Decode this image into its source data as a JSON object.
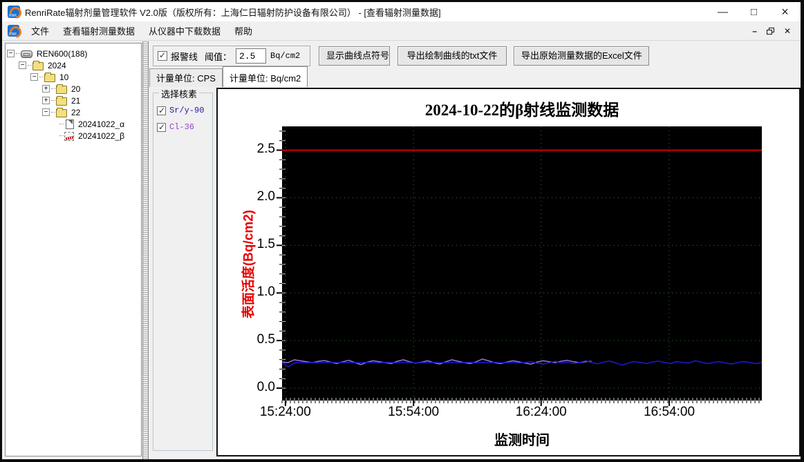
{
  "window": {
    "title": "RenriRate辐射剂量管理软件 V2.0版（版权所有：上海仁日辐射防护设备有限公司） - [查看辐射测量数据]",
    "minimize": "—",
    "maximize": "□",
    "close": "×",
    "mdi_minimize": "–",
    "mdi_close": "✕"
  },
  "menu": {
    "items": [
      "文件",
      "查看辐射测量数据",
      "从仪器中下载数据",
      "帮助"
    ]
  },
  "tree": {
    "items": [
      {
        "level": 0,
        "expander": "-",
        "icon": "device",
        "label": "REN600(188)",
        "selected": false
      },
      {
        "level": 1,
        "expander": "-",
        "icon": "folder",
        "label": "2024",
        "selected": false
      },
      {
        "level": 2,
        "expander": "-",
        "icon": "folder",
        "label": "10",
        "selected": false
      },
      {
        "level": 3,
        "expander": "+",
        "icon": "folder",
        "label": "20",
        "selected": false
      },
      {
        "level": 3,
        "expander": "+",
        "icon": "folder",
        "label": "21",
        "selected": false
      },
      {
        "level": 3,
        "expander": "-",
        "icon": "folder",
        "label": "22",
        "selected": false
      },
      {
        "level": 4,
        "expander": null,
        "icon": "doc",
        "label": "20241022_α",
        "selected": false
      },
      {
        "level": 4,
        "expander": null,
        "icon": "chart",
        "label": "20241022_β",
        "selected": true
      }
    ]
  },
  "toolbar": {
    "alarm_label": "报警线",
    "alarm_checked": true,
    "threshold_label": "阈值：",
    "threshold_value": "2.5",
    "threshold_unit": "Bq/cm2",
    "show_points_button": "显示曲线点符号",
    "export_txt_button": "导出绘制曲线的txt文件",
    "export_excel_button": "导出原始测量数据的Excel文件"
  },
  "tabs": [
    {
      "label": "计量单位: CPS",
      "active": false
    },
    {
      "label": "计量单位: Bq/cm2",
      "active": true
    }
  ],
  "nuclide_panel": {
    "title": "选择核素",
    "items": [
      {
        "label": "Sr/y-90",
        "checked": true,
        "color": "#24159a"
      },
      {
        "label": "Cl-36",
        "checked": true,
        "color": "#9b3fc9"
      }
    ]
  },
  "chart_data": {
    "type": "line",
    "title": "2024-10-22的β射线监测数据",
    "xlabel": "监测时间",
    "ylabel": "表面活度(Bq/cm2)",
    "ylabel_color": "#e60000",
    "plot_bg": "#000000",
    "grid_color": "#2e7d2e",
    "grid": true,
    "ylim": [
      -0.13,
      2.75
    ],
    "yticks": [
      0.0,
      0.5,
      1.0,
      1.5,
      2.0,
      2.5
    ],
    "ytick_labels": [
      "0.0",
      "0.5",
      "1.0",
      "1.5",
      "2.0",
      "2.5"
    ],
    "xtick_labels": [
      "15:24:00",
      "15:54:00",
      "16:24:00",
      "16:54:00"
    ],
    "xtick_fractions": [
      0.007,
      0.274,
      0.54,
      0.807
    ],
    "alarm_line": {
      "value": 2.5,
      "color": "#d40000"
    },
    "series": [
      {
        "name": "Cl-36",
        "color": "#9a74d8",
        "x_start": 0,
        "x_end": 0.645,
        "values": [
          0.275,
          0.268,
          0.298,
          0.288,
          0.278,
          0.268,
          0.283,
          0.29,
          0.273,
          0.258,
          0.278,
          0.293,
          0.268,
          0.248,
          0.273,
          0.288,
          0.278,
          0.268,
          0.258,
          0.283,
          0.298,
          0.278,
          0.263,
          0.273,
          0.288,
          0.268,
          0.253,
          0.278,
          0.298,
          0.283,
          0.268,
          0.258,
          0.278,
          0.305,
          0.288,
          0.268,
          0.258,
          0.273,
          0.288,
          0.278,
          0.263,
          0.253,
          0.273,
          0.288,
          0.278,
          0.268,
          0.283,
          0.293,
          0.278,
          0.268,
          0.278,
          0.283
        ]
      },
      {
        "name": "Sr/y-90",
        "color": "#1b1bd6",
        "x_start": 0,
        "x_end": 1,
        "values": [
          0.27,
          0.225,
          0.265,
          0.27,
          0.268,
          0.271,
          0.267,
          0.27,
          0.272,
          0.268,
          0.27,
          0.271,
          0.267,
          0.269,
          0.272,
          0.269,
          0.267,
          0.271,
          0.269,
          0.267,
          0.272,
          0.269,
          0.266,
          0.27,
          0.268,
          0.271,
          0.267,
          0.269,
          0.272,
          0.267,
          0.269,
          0.271,
          0.267,
          0.27,
          0.268,
          0.272,
          0.267,
          0.269,
          0.271,
          0.266,
          0.269,
          0.278,
          0.262,
          0.252,
          0.268,
          0.283,
          0.264,
          0.274,
          0.258,
          0.27,
          0.288,
          0.27,
          0.256,
          0.274,
          0.284,
          0.264,
          0.242,
          0.264,
          0.279,
          0.269,
          0.259,
          0.274,
          0.284,
          0.269,
          0.259,
          0.279,
          0.269,
          0.264,
          0.288,
          0.274,
          0.259,
          0.269,
          0.279,
          0.264,
          0.254,
          0.269,
          0.279,
          0.269,
          0.258,
          0.268
        ]
      }
    ]
  }
}
